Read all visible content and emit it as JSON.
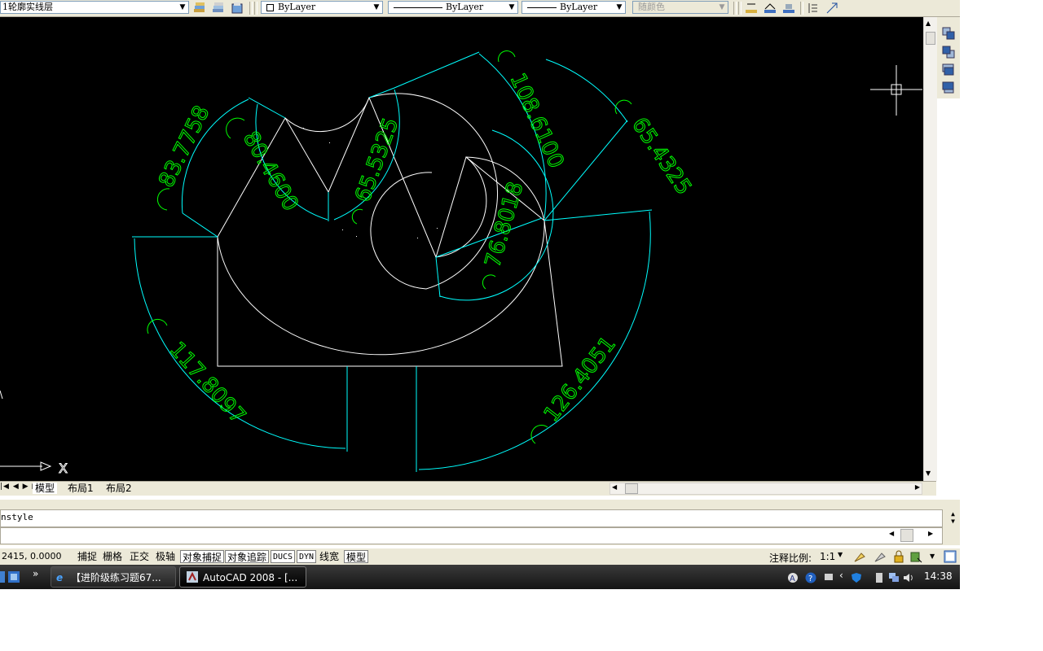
{
  "toolbar": {
    "layer_name": "1轮廓实线层",
    "color_value": "ByLayer",
    "linetype_value": "ByLayer",
    "lineweight_value": "ByLayer",
    "plotstyle_value": "随颜色"
  },
  "drawing": {
    "dimensions": [
      "83.7758",
      "80.4600",
      "65.5325",
      "108.6100",
      "65.4325",
      "76.8018",
      "117.8097",
      "126.4051"
    ],
    "ucs_axis_label": "X",
    "colors": {
      "geometry": "#ffffff",
      "dim_lines": "#00ffff",
      "dim_text": "#00ff00",
      "background": "#000000"
    }
  },
  "layout_tabs": {
    "tabs": [
      "模型",
      "布局1",
      "布局2"
    ]
  },
  "command": {
    "history": "nstyle",
    "prompt": ""
  },
  "status": {
    "coordinates": "2415, 0.0000",
    "toggles": [
      "捕捉",
      "栅格",
      "正交",
      "极轴",
      "对象捕捉",
      "对象追踪",
      "DUCS",
      "DYN",
      "线宽",
      "模型"
    ],
    "annotation_scale_label": "注释比例:",
    "annotation_scale_value": "1:1"
  },
  "taskbar": {
    "overflow": "»",
    "tasks": [
      "【进阶级练习题67...",
      "AutoCAD 2008 - [..."
    ],
    "clock": "14:38"
  }
}
